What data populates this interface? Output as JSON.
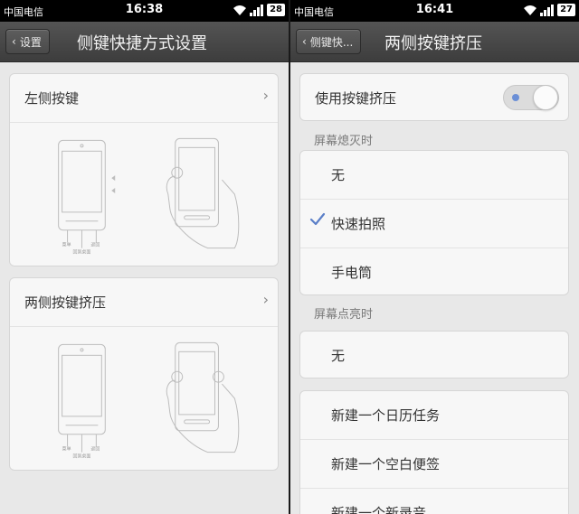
{
  "left_screen": {
    "status": {
      "carrier": "中国电信",
      "time": "16:38",
      "battery": "28"
    },
    "back_label": "设置",
    "title": "侧键快捷方式设置",
    "cards": [
      {
        "label": "左侧按键",
        "illus": {
          "menu": "菜单",
          "home": "回到桌面",
          "back": "返回"
        }
      },
      {
        "label": "两侧按键挤压",
        "illus": {
          "menu": "菜单",
          "home": "回到桌面",
          "back": "返回"
        }
      }
    ]
  },
  "right_screen": {
    "status": {
      "carrier": "中国电信",
      "time": "16:41",
      "battery": "27"
    },
    "back_label": "侧键快...",
    "title": "两侧按键挤压",
    "toggle_label": "使用按键挤压",
    "toggle_on": true,
    "section_off": "屏幕熄灭时",
    "off_options": [
      "无",
      "快速拍照",
      "手电筒"
    ],
    "off_selected_index": 1,
    "section_on": "屏幕点亮时",
    "on_options": [
      "无"
    ],
    "extra_options": [
      "新建一个日历任务",
      "新建一个空白便签",
      "新建一个新录音"
    ]
  },
  "colors": {
    "accent": "#6b8fd6",
    "check": "#5b7fc8",
    "titlebar": "#474747",
    "background": "#e8e8e8"
  }
}
